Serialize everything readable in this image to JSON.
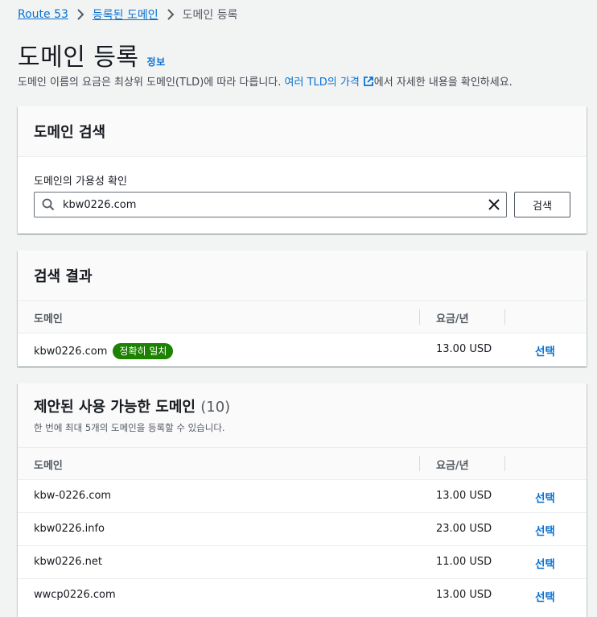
{
  "breadcrumb": {
    "items": [
      "Route 53",
      "등록된 도메인"
    ],
    "current": "도메인 등록"
  },
  "page": {
    "title": "도메인 등록",
    "info_link": "정보",
    "description_prefix": "도메인 이름의 요금은 최상위 도메인(TLD)에 따라 다릅니다. ",
    "description_link": "여러 TLD의 가격",
    "description_suffix": "에서 자세한 내용을 확인하세요."
  },
  "search_panel": {
    "title": "도메인 검색",
    "field_label": "도메인의 가용성 확인",
    "input_value": "kbw0226.com",
    "search_button": "검색"
  },
  "results_panel": {
    "title": "검색 결과",
    "columns": [
      "도메인",
      "요금/년"
    ],
    "rows": [
      {
        "domain": "kbw0226.com",
        "badge": "정확히 일치",
        "price": "13.00 USD",
        "action": "선택"
      }
    ]
  },
  "suggested_panel": {
    "title": "제안된 사용 가능한 도메인",
    "count": "(10)",
    "subtitle": "한 번에 최대 5개의 도메인을 등록할 수 있습니다.",
    "columns": [
      "도메인",
      "요금/년"
    ],
    "rows": [
      {
        "domain": "kbw-0226.com",
        "price": "13.00 USD",
        "action": "선택"
      },
      {
        "domain": "kbw0226.info",
        "price": "23.00 USD",
        "action": "선택"
      },
      {
        "domain": "kbw0226.net",
        "price": "11.00 USD",
        "action": "선택"
      },
      {
        "domain": "wwcp0226.com",
        "price": "13.00 USD",
        "action": "선택"
      }
    ]
  },
  "colors": {
    "link": "#0972d3",
    "badge": "#1d8102",
    "background": "#f2f3f3"
  },
  "icons": [
    "chevron-right-icon",
    "external-link-icon",
    "search-icon",
    "clear-icon"
  ]
}
